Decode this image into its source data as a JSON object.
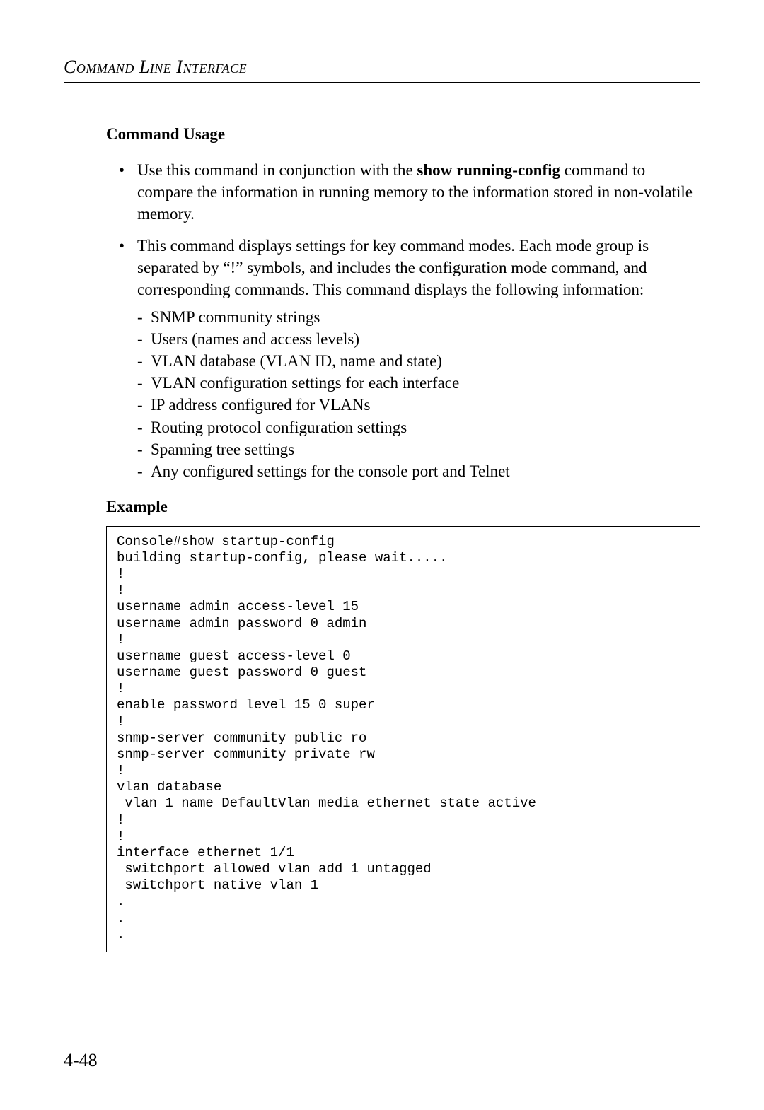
{
  "header": {
    "running_head": "Command Line Interface"
  },
  "body": {
    "section_title": "Command Usage",
    "bullets": {
      "b1_pre": "Use this command in conjunction with the ",
      "b1_bold": "show running-config",
      "b1_post": " command to compare the information in running memory to the information stored in non-volatile memory.",
      "b2": "This command displays settings for key command modes. Each mode group is separated by “!” symbols, and includes the configuration mode command, and corresponding commands. This command displays the following information:",
      "sub": {
        "s1": "SNMP community strings",
        "s2": "Users (names and access levels)",
        "s3": "VLAN database (VLAN ID, name and state)",
        "s4": "VLAN configuration settings for each interface",
        "s5": "IP address configured for VLANs",
        "s6": "Routing protocol configuration settings",
        "s7": "Spanning tree settings",
        "s8": "Any configured settings for the console port and Telnet"
      }
    },
    "example_heading": "Example",
    "code": "Console#show startup-config\nbuilding startup-config, please wait.....\n!\n!\nusername admin access-level 15\nusername admin password 0 admin\n!\nusername guest access-level 0\nusername guest password 0 guest\n!\nenable password level 15 0 super\n!\nsnmp-server community public ro\nsnmp-server community private rw\n!\nvlan database\n vlan 1 name DefaultVlan media ethernet state active\n!\n!\ninterface ethernet 1/1\n switchport allowed vlan add 1 untagged\n switchport native vlan 1\n.\n.\n."
  },
  "footer": {
    "page_number": "4-48"
  }
}
